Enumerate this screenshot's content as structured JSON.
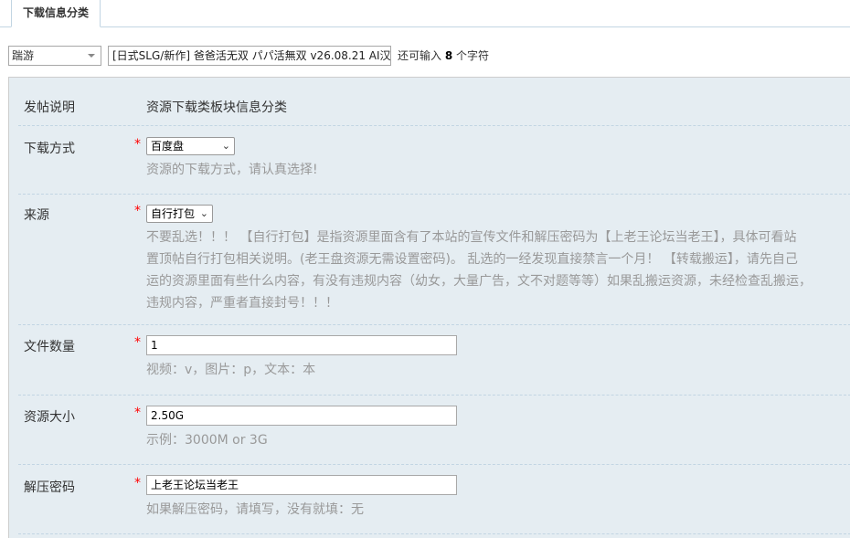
{
  "tab": {
    "label": "下载信息分类"
  },
  "subject": {
    "type_value": "踹游",
    "title_value": "[日式SLG/新作] 爸爸活无双 パパ活無双 v26.08.21 AI汉化",
    "hint_prefix": "还可输入",
    "hint_count": "8",
    "hint_suffix": "个字符"
  },
  "form": {
    "intro": {
      "label": "发帖说明",
      "value": "资源下载类板块信息分类"
    },
    "download_method": {
      "label": "下载方式",
      "required": "*",
      "selected": "百度盘",
      "hint": "资源的下载方式，请认真选择!"
    },
    "source": {
      "label": "来源",
      "required": "*",
      "selected": "自行打包",
      "hint_lines": [
        "不要乱选！！！ 【自行打包】是指资源里面含有了本站的宣传文件和解压密码为【上老王论坛当老王】，具体可看站",
        "置顶帖自行打包相关说明。(老王盘资源无需设置密码)。 乱选的一经发现直接禁言一个月！ 【转载搬运】，请先自己",
        "运的资源里面有些什么内容，有没有违规内容（幼女，大量广告，文不对题等等）如果乱搬运资源，未经检查乱搬运，",
        "违规内容，严重者直接封号！！！"
      ]
    },
    "file_count": {
      "label": "文件数量",
      "required": "*",
      "value": "1",
      "hint": "视频：v，图片：p，文本：本"
    },
    "size": {
      "label": "资源大小",
      "required": "*",
      "value": "2.50G",
      "hint": "示例：3000M or 3G"
    },
    "password": {
      "label": "解压密码",
      "required": "*",
      "value": "上老王论坛当老王",
      "hint": "如果解压密码，请填写，没有就填：无"
    }
  }
}
